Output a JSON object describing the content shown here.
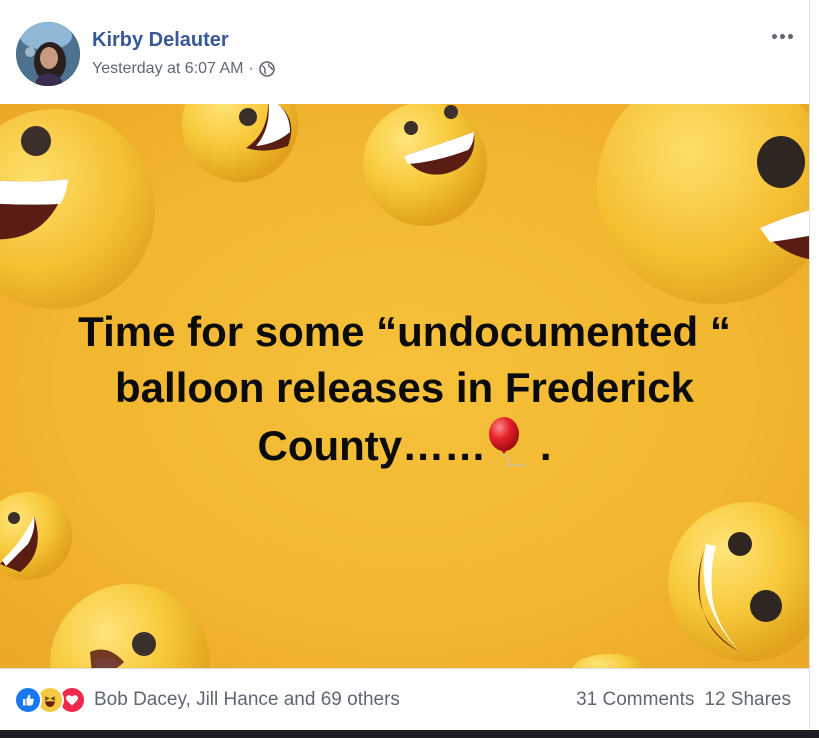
{
  "post": {
    "author": "Kirby Delauter",
    "timestamp": "Yesterday at 6:07 AM",
    "separator": "·",
    "privacy_icon": "globe-icon",
    "more_icon": "more-options-icon"
  },
  "image": {
    "text_line1": "Time for some “undocumented “",
    "text_line2": "balloon releases in Frederick",
    "text_line3_before": "County……",
    "text_line3_after": " .",
    "emoji": "red-balloon",
    "background_color": "#f2b630"
  },
  "footer": {
    "reaction_icons": [
      "like-icon",
      "haha-icon",
      "love-icon"
    ],
    "reactors": "Bob Dacey, Jill Hance and 69 others",
    "comments": "31 Comments",
    "shares": "12 Shares"
  },
  "colors": {
    "author_link": "#385898",
    "meta_text": "#616770",
    "like": "#1877f2",
    "love": "#f0284a",
    "haha": "#f7c942"
  }
}
